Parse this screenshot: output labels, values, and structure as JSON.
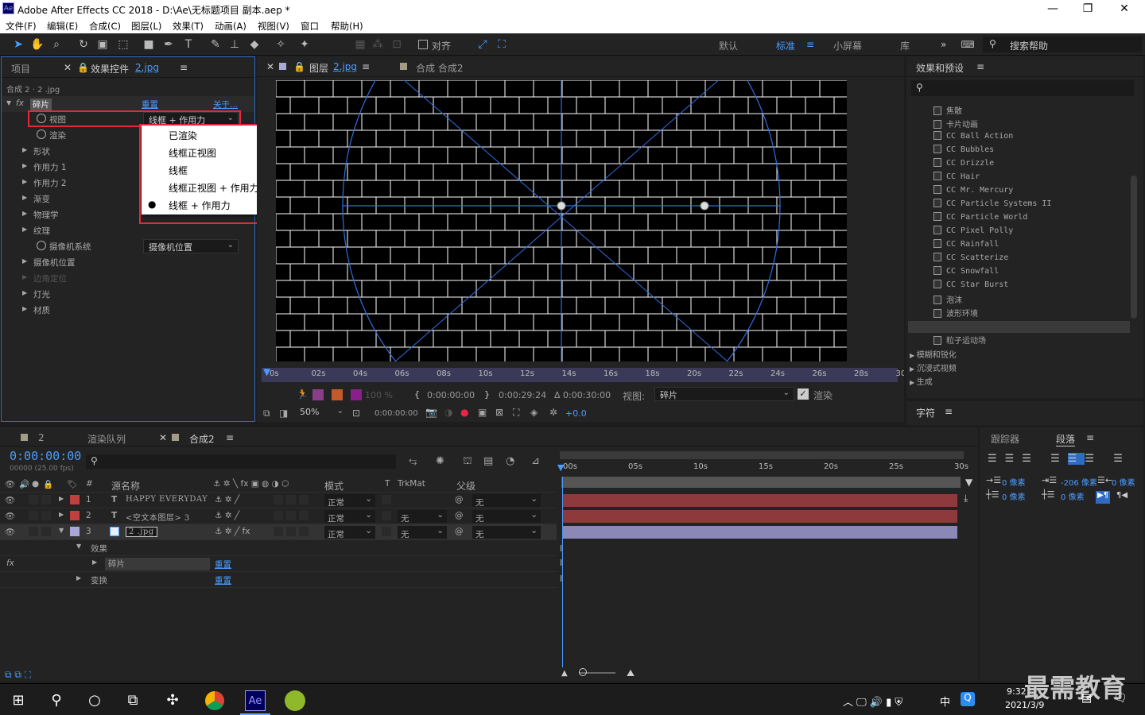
{
  "title": "Adobe After Effects CC 2018 - D:\\Ae\\无标题项目 副本.aep *",
  "menu": [
    "文件(F)",
    "编辑(E)",
    "合成(C)",
    "图层(L)",
    "效果(T)",
    "动画(A)",
    "视图(V)",
    "窗口",
    "帮助(H)"
  ],
  "toolbar": {
    "align_label": "对齐",
    "search_placeholder": "搜索帮助"
  },
  "workspaces": [
    "默认",
    "标准",
    "小屏幕",
    "库"
  ],
  "left_panel": {
    "tab_project": "项目",
    "tab_effect_controls": "效果控件",
    "tab_effect_file": "2.jpg",
    "layer_path": "合成 2 · 2 .jpg",
    "effect_name": "碎片",
    "reset": "重置",
    "about": "关于...",
    "properties": [
      {
        "label": "视图",
        "stopwatch": true,
        "value": "线框 + 作用力"
      },
      {
        "label": "渲染",
        "stopwatch": true
      },
      {
        "label": "形状"
      },
      {
        "label": "作用力 1"
      },
      {
        "label": "作用力 2"
      },
      {
        "label": "渐变"
      },
      {
        "label": "物理学"
      },
      {
        "label": "纹理"
      },
      {
        "label": "摄像机系统",
        "stopwatch": true,
        "value": "摄像机位置"
      },
      {
        "label": "摄像机位置"
      },
      {
        "label": "边角定位"
      },
      {
        "label": "灯光"
      },
      {
        "label": "材质"
      }
    ],
    "popup_options": [
      "已渲染",
      "线框正视图",
      "线框",
      "线框正视图 + 作用力",
      "线框 + 作用力"
    ],
    "popup_selected": 4
  },
  "viewer": {
    "tab_layer": "图层",
    "tab_layer_file": "2.jpg",
    "tab_comp": "合成 合成2",
    "ruler": [
      "0s",
      "02s",
      "04s",
      "06s",
      "08s",
      "10s",
      "12s",
      "14s",
      "16s",
      "18s",
      "20s",
      "22s",
      "24s",
      "26s",
      "28s",
      "30s"
    ],
    "opacity": "100 %",
    "time_in": "0:00:00:00",
    "time_out": "0:00:29:24",
    "duration": "Δ 0:00:30:00",
    "view_label": "视图:",
    "view_value": "碎片",
    "render_label": "渲染",
    "zoom": "50%",
    "current_time": "0:00:00:00",
    "exposure": "+0.0"
  },
  "effects_panel": {
    "title": "效果和预设",
    "items": [
      "焦散",
      "卡片动画",
      "CC Ball Action",
      "CC Bubbles",
      "CC Drizzle",
      "CC Hair",
      "CC Mr. Mercury",
      "CC Particle Systems II",
      "CC Particle World",
      "CC Pixel Polly",
      "CC Rainfall",
      "CC Scatterize",
      "CC Snowfall",
      "CC Star Burst",
      "泡沫",
      "波形环境",
      "碎片",
      "粒子运动场"
    ],
    "selected": "碎片",
    "groups": [
      "模糊和锐化",
      "沉浸式视频",
      "生成"
    ]
  },
  "character_panel": {
    "title": "字符"
  },
  "paragraph_panel": {
    "tab_tracker": "跟踪器",
    "tab_paragraph": "段落",
    "indent_left": "0 像素",
    "indent_first": "-206 像素",
    "indent_right": "0 像素",
    "space_before": "0 像素",
    "space_after": "0 像素"
  },
  "timeline": {
    "tab_render_queue": "渲染队列",
    "tab_comp": "合成2",
    "tab_2": "2",
    "timecode": "0:00:00:00",
    "frame_info": "00000 (25.00 fps)",
    "col_source": "源名称",
    "col_mode": "模式",
    "col_t": "T",
    "col_trkmat": "TrkMat",
    "col_parent": "父级",
    "ruler": [
      "00s",
      "05s",
      "10s",
      "15s",
      "20s",
      "25s",
      "30s"
    ],
    "layers": [
      {
        "num": "1",
        "type": "T",
        "name": "HAPPY EVERYDAY",
        "mode": "正常",
        "trkmat": "",
        "parent": "无",
        "color": "#c0403f"
      },
      {
        "num": "2",
        "type": "T",
        "name": "<空文本图层> 3",
        "mode": "正常",
        "trkmat": "无",
        "parent": "无",
        "color": "#c0403f"
      },
      {
        "num": "3",
        "type": "img",
        "name": "2 .jpg",
        "mode": "正常",
        "trkmat": "无",
        "parent": "无",
        "color": "#a9a6d8"
      }
    ],
    "sub_effects": "效果",
    "sub_effect_name": "碎片",
    "sub_reset": "重置",
    "sub_transform": "变换",
    "sub_transform_reset": "重置"
  },
  "taskbar": {
    "time": "9:32",
    "date": "2021/3/9",
    "ime": "中",
    "watermark": "最需教育"
  }
}
